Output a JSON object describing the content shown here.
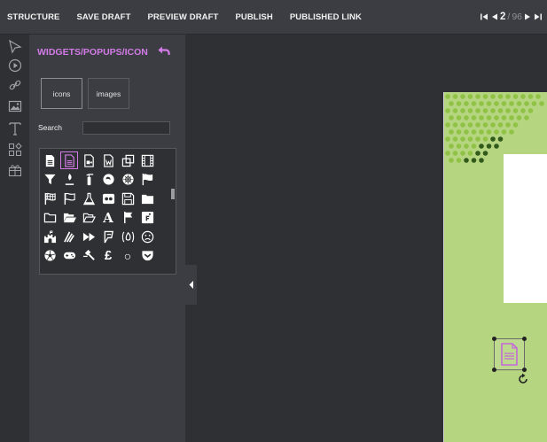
{
  "topbar": {
    "structure": "STRUCTURE",
    "save_draft": "SAVE DRAFT",
    "preview_draft": "PREVIEW DRAFT",
    "publish": "PUBLISH",
    "published_link": "PUBLISHED LINK"
  },
  "pager": {
    "current": "2",
    "separator": "/",
    "total": "96"
  },
  "panel": {
    "title": "WIDGETS/POPUPS/ICON",
    "tab_icons": "icons",
    "tab_images": "images",
    "search_label": "Search",
    "search_value": ""
  },
  "icon_grid": [
    "file-icon",
    "file-text-icon",
    "file-video-icon",
    "file-word-icon",
    "clone-icon",
    "film-icon",
    "filter-icon",
    "fire-extinguisher-icon",
    "fire-extinguisher-icon",
    "firefox-icon",
    "first-order-icon",
    "flag-icon",
    "flag-checkered-icon",
    "flag-outline-icon",
    "flask-icon",
    "flickr-icon",
    "floppy-icon",
    "folder-icon",
    "folder-outline-icon",
    "folder-open-icon",
    "folder-open-outline-icon",
    "font-icon",
    "fort-awesome-icon",
    "font-awesome-icon",
    "fort-icon",
    "feed-icon",
    "forward-icon",
    "foursquare-icon",
    "fire-icon",
    "frown-icon",
    "futbol-icon",
    "gamepad-icon",
    "gavel-icon",
    "gbp-icon",
    "genderless-icon",
    "get-pocket-icon"
  ],
  "glyphs": {
    "font": "A",
    "gbp": "£",
    "genderless": "○"
  },
  "colors": {
    "accent": "#d37be6",
    "canvas_green": "#b6d580",
    "dot_light": "#8fc245",
    "dot_dark": "#2f5a1a"
  }
}
